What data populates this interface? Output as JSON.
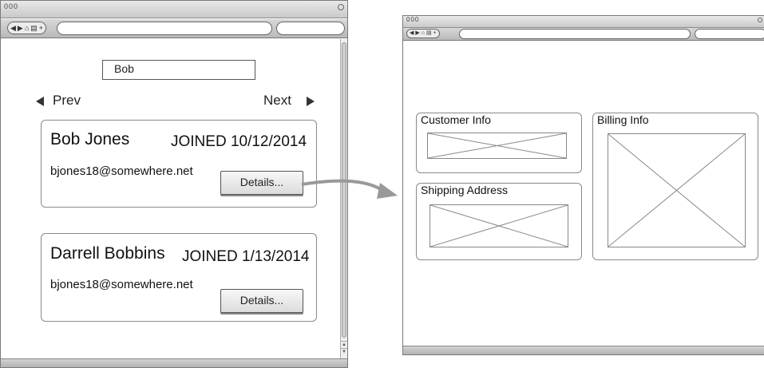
{
  "left_window": {
    "search": {
      "value": "Bob"
    },
    "pager": {
      "prev_label": "Prev",
      "next_label": "Next"
    },
    "customers": [
      {
        "name": "Bob Jones",
        "joined": "JOINED 10/12/2014",
        "email": "bjones18@somewhere.net",
        "details_label": "Details..."
      },
      {
        "name": "Darrell Bobbins",
        "joined": "JOINED 1/13/2014",
        "email": "bjones18@somewhere.net",
        "details_label": "Details..."
      }
    ]
  },
  "right_window": {
    "panels": {
      "customer_info": "Customer Info",
      "shipping_address": "Shipping Address",
      "billing_info": "Billing Info"
    }
  },
  "chrome": {
    "title_dots": "000"
  },
  "colors": {
    "connector_arrow": "#999999",
    "chrome_gray": "#c9c9c9"
  }
}
